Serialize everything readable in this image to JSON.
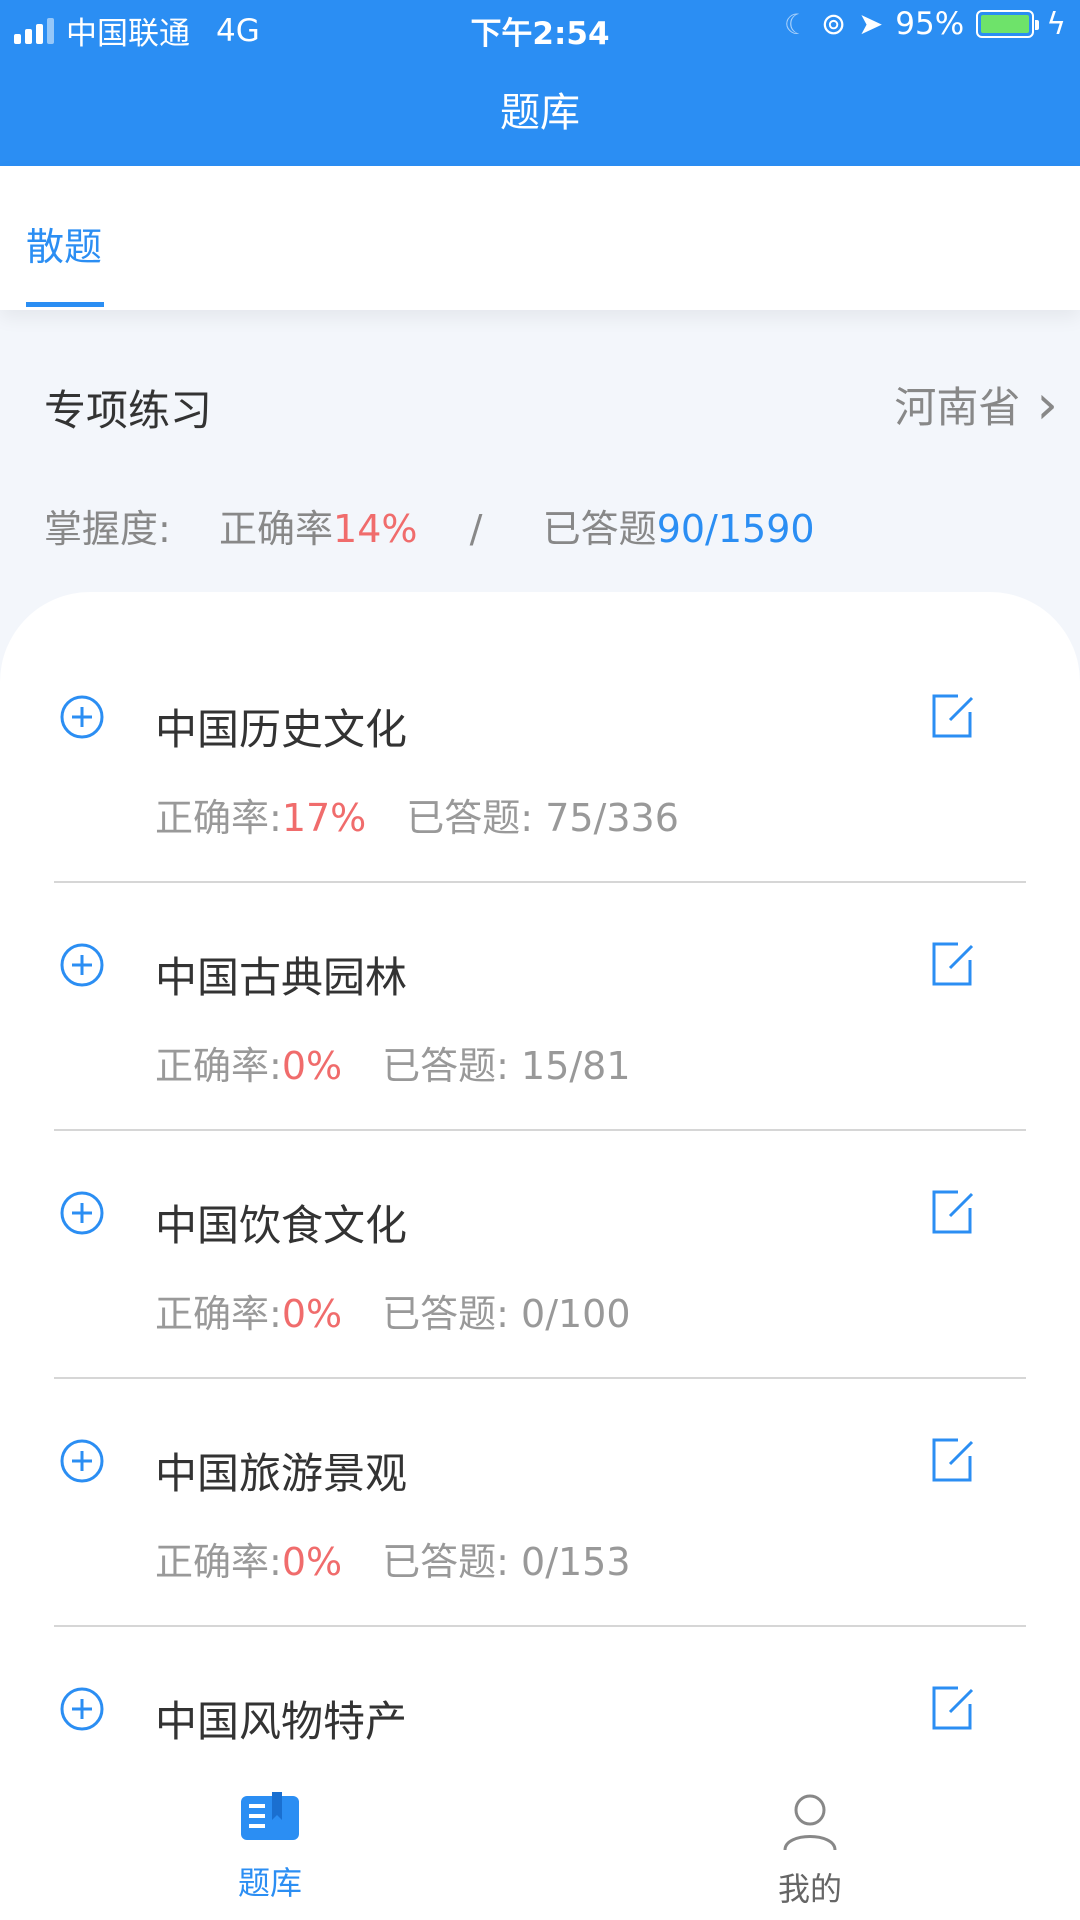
{
  "status": {
    "carrier": "中国联通",
    "network": "4G",
    "time": "下午2:54",
    "battery": "95%"
  },
  "header": {
    "title": "题库"
  },
  "tabs": [
    {
      "label": "散题"
    }
  ],
  "section": {
    "title": "专项练习",
    "region": "河南省",
    "mastery_label": "掌握度:",
    "accuracy_label": "正确率",
    "accuracy_value": "14%",
    "separator": "/",
    "answered_label": "已答题",
    "answered_value": "90/1590"
  },
  "items": [
    {
      "title": "中国历史文化",
      "acc_label": "正确率:",
      "acc": "17%",
      "ans_label": "已答题:",
      "ans": "75/336"
    },
    {
      "title": "中国古典园林",
      "acc_label": "正确率:",
      "acc": "0%",
      "ans_label": "已答题:",
      "ans": "15/81"
    },
    {
      "title": "中国饮食文化",
      "acc_label": "正确率:",
      "acc": "0%",
      "ans_label": "已答题:",
      "ans": "0/100"
    },
    {
      "title": "中国旅游景观",
      "acc_label": "正确率:",
      "acc": "0%",
      "ans_label": "已答题:",
      "ans": "0/153"
    },
    {
      "title": "中国风物特产",
      "acc_label": "",
      "acc": "",
      "ans_label": "",
      "ans": ""
    }
  ],
  "bottom_nav": {
    "bank": "题库",
    "me": "我的"
  },
  "colors": {
    "primary": "#2b8ef3",
    "accent_red": "#f06c6c"
  }
}
